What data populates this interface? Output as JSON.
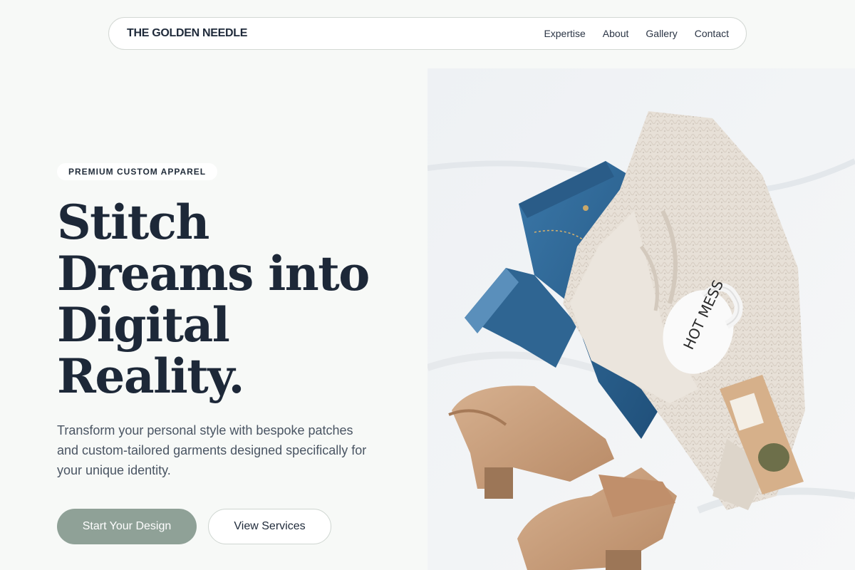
{
  "brand": {
    "name": "THE GOLDEN NEEDLE"
  },
  "nav": {
    "links": [
      "Expertise",
      "About",
      "Gallery",
      "Contact"
    ]
  },
  "hero": {
    "badge": "PREMIUM CUSTOM APPAREL",
    "headline": "Stitch Dreams into Digital Reality.",
    "subtext": "Transform your personal style with bespoke patches and custom-tailored garments designed specifically for your unique identity.",
    "primary_button": "Start Your Design",
    "secondary_button": "View Services"
  },
  "image": {
    "description_icon": "flatlay-photo",
    "mug_text": "HOT MESS"
  },
  "colors": {
    "background": "#f7f9f7",
    "primary_button": "#8fa197",
    "text_dark": "#1d2838",
    "denim": "#2f6592",
    "sweater": "#e6dfd6",
    "suede": "#c99f7e"
  }
}
